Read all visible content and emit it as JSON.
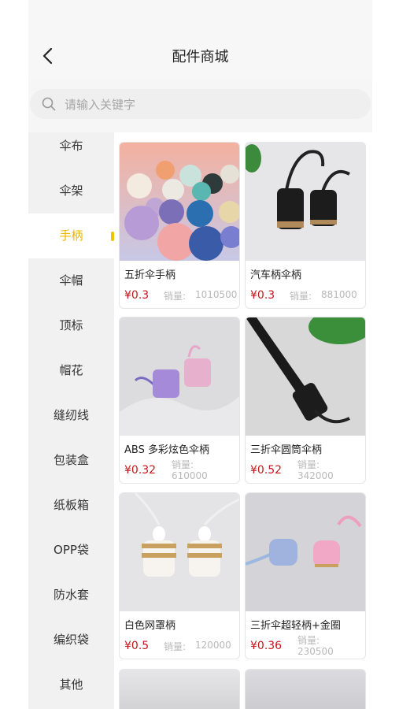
{
  "header": {
    "title": "配件商城"
  },
  "search": {
    "placeholder": "请输入关键字"
  },
  "categories": [
    "伞布",
    "伞架",
    "手柄",
    "伞帽",
    "顶标",
    "帽花",
    "缝纫线",
    "包装盒",
    "纸板箱",
    "OPP袋",
    "防水套",
    "编织袋",
    "其他"
  ],
  "active_category": "手柄",
  "sales_label": "销量:",
  "products": [
    {
      "name": "五折伞手柄",
      "price": "¥0.3",
      "sales": "1010500"
    },
    {
      "name": "汽车柄伞柄",
      "price": "¥0.3",
      "sales": "881000"
    },
    {
      "name": "ABS 多彩炫色伞柄",
      "price": "¥0.32",
      "sales": "610000"
    },
    {
      "name": "三折伞圆筒伞柄",
      "price": "¥0.52",
      "sales": "342000"
    },
    {
      "name": "白色网罩柄",
      "price": "¥0.5",
      "sales": "120000"
    },
    {
      "name": "三折伞超轻柄+金圈",
      "price": "¥0.36",
      "sales": "230500"
    }
  ]
}
